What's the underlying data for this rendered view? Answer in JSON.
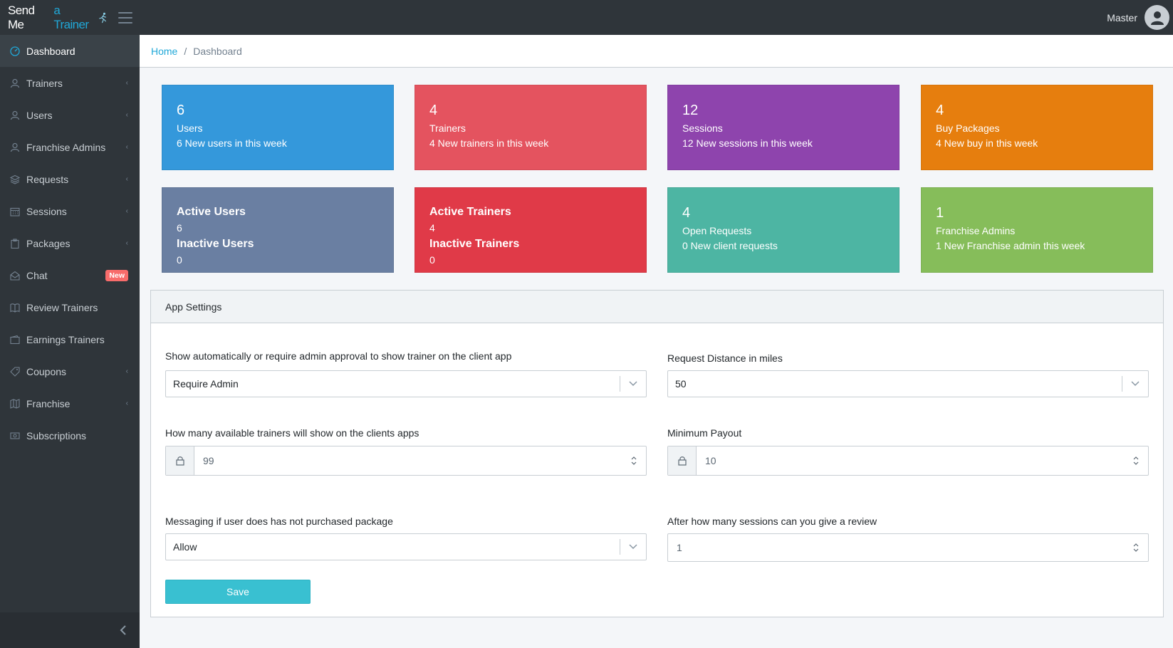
{
  "brand": {
    "part1": "Send Me",
    "part2": "a Trainer"
  },
  "header": {
    "user_name": "Master"
  },
  "breadcrumb": {
    "home": "Home",
    "separator": "/",
    "current": "Dashboard"
  },
  "sidebar": {
    "items": [
      {
        "label": "Dashboard",
        "icon": "speedometer-icon",
        "active": true
      },
      {
        "label": "Trainers",
        "icon": "user-icon",
        "caret": "‹"
      },
      {
        "label": "Users",
        "icon": "user-icon",
        "caret": "‹"
      },
      {
        "label": "Franchise Admins",
        "icon": "user-icon",
        "caret": "‹"
      },
      {
        "label": "Requests",
        "icon": "layers-icon",
        "caret": "‹"
      },
      {
        "label": "Sessions",
        "icon": "calendar-icon",
        "caret": "‹"
      },
      {
        "label": "Packages",
        "icon": "clipboard-icon",
        "caret": "‹"
      },
      {
        "label": "Chat",
        "icon": "envelope-icon",
        "badge": "New"
      },
      {
        "label": "Review Trainers",
        "icon": "book-icon"
      },
      {
        "label": "Earnings Trainers",
        "icon": "wallet-icon"
      },
      {
        "label": "Coupons",
        "icon": "tag-icon",
        "caret": "‹"
      },
      {
        "label": "Franchise",
        "icon": "map-icon",
        "caret": "‹"
      },
      {
        "label": "Subscriptions",
        "icon": "cash-icon"
      }
    ]
  },
  "cards": {
    "users": {
      "num": "6",
      "label": "Users",
      "sub": "6 New users in this week",
      "color": "#3498db"
    },
    "trainers": {
      "num": "4",
      "label": "Trainers",
      "sub": "4 New trainers in this week",
      "color": "#e4535f"
    },
    "sessions": {
      "num": "12",
      "label": "Sessions",
      "sub": "12 New sessions in this week",
      "color": "#8e44ad"
    },
    "packages": {
      "num": "4",
      "label": "Buy Packages",
      "sub": "4 New buy in this week",
      "color": "#e67e0e"
    },
    "active_users": {
      "t1": "Active Users",
      "v1": "6",
      "t2": "Inactive Users",
      "v2": "0",
      "color": "#6a7fa2"
    },
    "active_trainers": {
      "t1": "Active Trainers",
      "v1": "4",
      "t2": "Inactive Trainers",
      "v2": "0",
      "color": "#e03a48"
    },
    "requests": {
      "num": "4",
      "label": "Open Requests",
      "sub": "0 New client requests",
      "color": "#4db5a3"
    },
    "franchise": {
      "num": "1",
      "label": "Franchise Admins",
      "sub": "1 New Franchise admin this week",
      "color": "#86bd5a"
    }
  },
  "settings": {
    "title": "App Settings",
    "approval_label": "Show automatically or require admin approval to show trainer on the client app",
    "approval_value": "Require Admin",
    "distance_label": "Request Distance in miles",
    "distance_value": "50",
    "available_label": "How many available trainers will show on the clients apps",
    "available_value": "99",
    "payout_label": "Minimum Payout",
    "payout_value": "10",
    "messaging_label": "Messaging if user does has not purchased package",
    "messaging_value": "Allow",
    "review_label": "After how many sessions can you give a review",
    "review_value": "1",
    "save_label": "Save"
  }
}
